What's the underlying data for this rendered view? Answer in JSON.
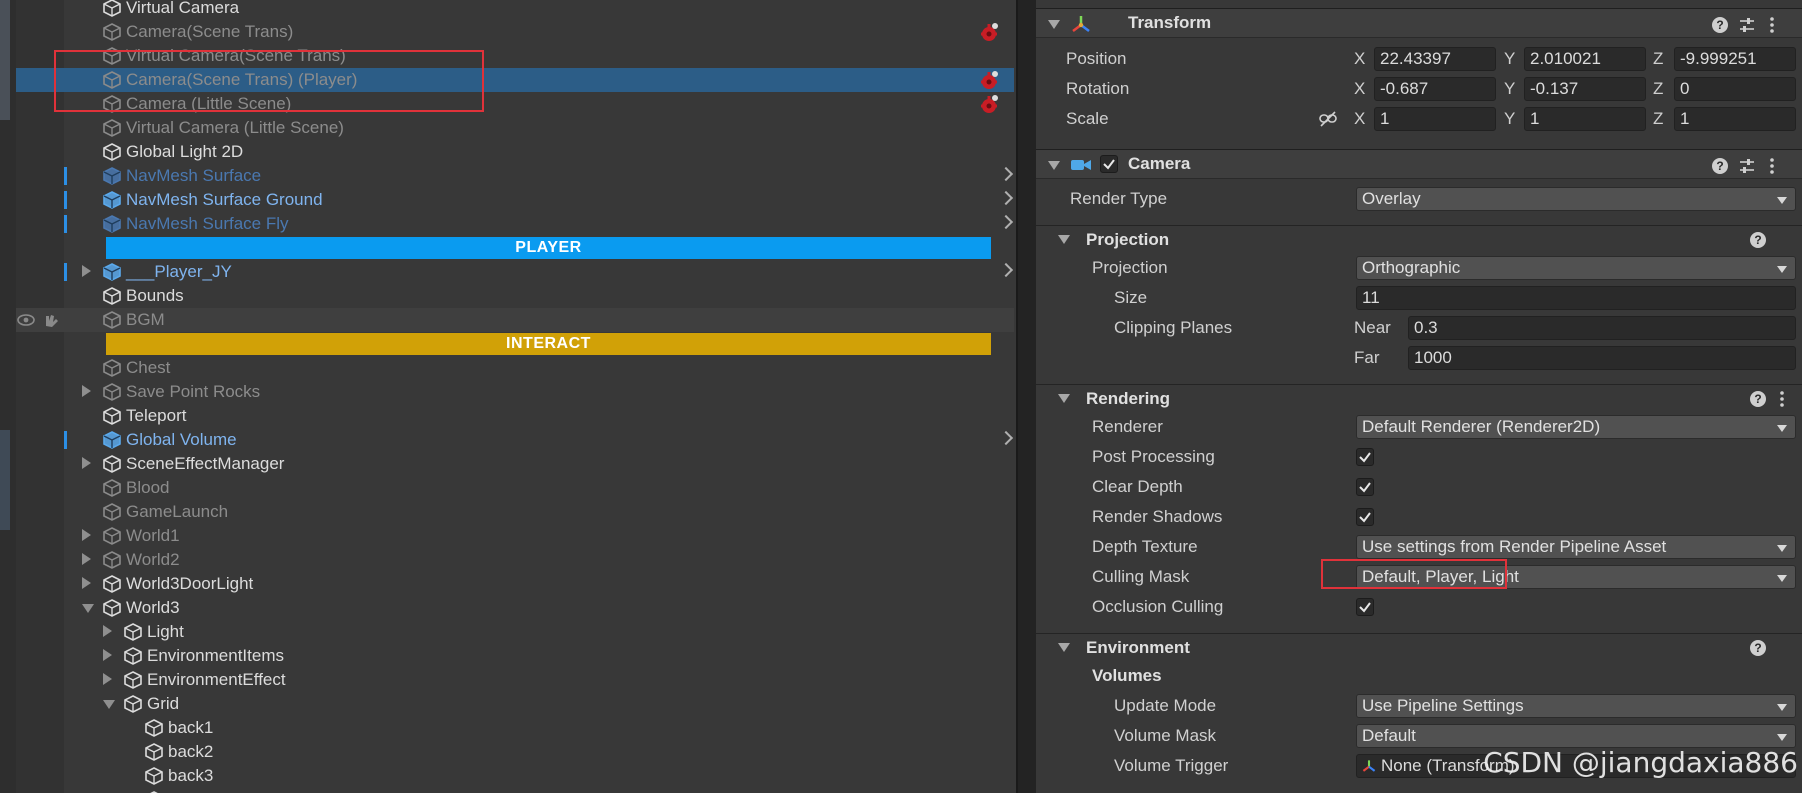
{
  "hierarchy": {
    "rows": [
      {
        "label": "Virtual Camera",
        "style": "normal",
        "depth": 0
      },
      {
        "label": "Camera(Scene Trans)",
        "style": "dim",
        "depth": 0,
        "gear": true
      },
      {
        "label": "Virtual Camera(Scene Trans)",
        "style": "dim",
        "depth": 0
      },
      {
        "label": "Camera(Scene Trans) (Player)",
        "style": "dim",
        "depth": 0,
        "gear": true,
        "selected": true
      },
      {
        "label": "Camera (Little Scene)",
        "style": "dim",
        "depth": 0,
        "gear": true
      },
      {
        "label": "Virtual Camera (Little Scene)",
        "style": "dim",
        "depth": 0
      },
      {
        "label": "Global Light 2D",
        "style": "normal",
        "depth": 0
      },
      {
        "label": "NavMesh Surface",
        "style": "prefab-dim",
        "depth": 0,
        "prefab": true,
        "chevron": true
      },
      {
        "label": "NavMesh Surface Ground",
        "style": "prefab",
        "depth": 0,
        "prefab": true,
        "chevron": true
      },
      {
        "label": "NavMesh Surface Fly",
        "style": "prefab-dim",
        "depth": 0,
        "prefab": true,
        "chevron": true
      },
      {
        "label": "PLAYER",
        "header": "#0a9bf0"
      },
      {
        "label": "___Player_JY",
        "style": "prefab",
        "depth": 0,
        "prefab": true,
        "chevron": true,
        "fold": "closed"
      },
      {
        "label": "Bounds",
        "style": "normal",
        "depth": 0
      },
      {
        "label": "BGM",
        "style": "dim",
        "depth": 0,
        "hovered": true
      },
      {
        "label": "INTERACT",
        "header": "#d1a107"
      },
      {
        "label": "Chest",
        "style": "dim",
        "depth": 0
      },
      {
        "label": "Save Point Rocks",
        "style": "dim",
        "depth": 0,
        "fold": "closed"
      },
      {
        "label": "Teleport",
        "style": "normal",
        "depth": 0
      },
      {
        "label": "Global Volume",
        "style": "prefab",
        "depth": 0,
        "prefab": true,
        "chevron": true
      },
      {
        "label": "SceneEffectManager",
        "style": "normal",
        "depth": 0,
        "fold": "closed"
      },
      {
        "label": "Blood",
        "style": "dim",
        "depth": 0
      },
      {
        "label": "GameLaunch",
        "style": "dim",
        "depth": 0
      },
      {
        "label": "World1",
        "style": "dim",
        "depth": 0,
        "fold": "closed"
      },
      {
        "label": "World2",
        "style": "dim",
        "depth": 0,
        "fold": "closed"
      },
      {
        "label": "World3DoorLight",
        "style": "normal",
        "depth": 0,
        "fold": "closed"
      },
      {
        "label": "World3",
        "style": "normal",
        "depth": 0,
        "fold": "open"
      },
      {
        "label": "Light",
        "style": "normal",
        "depth": 1,
        "fold": "closed"
      },
      {
        "label": "EnvironmentItems",
        "style": "normal",
        "depth": 1,
        "fold": "closed"
      },
      {
        "label": "EnvironmentEffect",
        "style": "normal",
        "depth": 1,
        "fold": "closed"
      },
      {
        "label": "Grid",
        "style": "normal",
        "depth": 1,
        "fold": "open"
      },
      {
        "label": "back1",
        "style": "normal",
        "depth": 2
      },
      {
        "label": "back2",
        "style": "normal",
        "depth": 2
      },
      {
        "label": "back3",
        "style": "normal",
        "depth": 2
      },
      {
        "label": "",
        "style": "normal",
        "depth": 2
      }
    ]
  },
  "inspector": {
    "transform": {
      "title": "Transform",
      "position": {
        "label": "Position",
        "x": "22.43397",
        "y": "2.010021",
        "z": "-9.999251"
      },
      "rotation": {
        "label": "Rotation",
        "x": "-0.687",
        "y": "-0.137",
        "z": "0"
      },
      "scale": {
        "label": "Scale",
        "x": "1",
        "y": "1",
        "z": "1"
      },
      "axis_x": "X",
      "axis_y": "Y",
      "axis_z": "Z"
    },
    "camera": {
      "title": "Camera",
      "enabled": true,
      "render_type": {
        "label": "Render Type",
        "value": "Overlay"
      },
      "projection_section": "Projection",
      "projection": {
        "label": "Projection",
        "value": "Orthographic"
      },
      "size": {
        "label": "Size",
        "value": "11"
      },
      "clipping": {
        "label": "Clipping Planes",
        "near_label": "Near",
        "near": "0.3",
        "far_label": "Far",
        "far": "1000"
      },
      "rendering_section": "Rendering",
      "renderer": {
        "label": "Renderer",
        "value": "Default Renderer (Renderer2D)"
      },
      "post_processing": {
        "label": "Post Processing",
        "checked": true
      },
      "clear_depth": {
        "label": "Clear Depth",
        "checked": true
      },
      "render_shadows": {
        "label": "Render Shadows",
        "checked": true
      },
      "depth_texture": {
        "label": "Depth Texture",
        "value": "Use settings from Render Pipeline Asset"
      },
      "culling_mask": {
        "label": "Culling Mask",
        "value": "Default, Player, Light"
      },
      "occlusion_culling": {
        "label": "Occlusion Culling",
        "checked": true
      },
      "environment_section": "Environment",
      "volumes_label": "Volumes",
      "update_mode": {
        "label": "Update Mode",
        "value": "Use Pipeline Settings"
      },
      "volume_mask": {
        "label": "Volume Mask",
        "value": "Default"
      },
      "volume_trigger": {
        "label": "Volume Trigger",
        "value": "None (Transform)"
      }
    }
  },
  "watermark": "CSDN @jiangdaxia886",
  "colors": {
    "selection": "#2c5d87",
    "highlight_box": "#e0323a",
    "player_header": "#0a9bf0",
    "interact_header": "#d1a107"
  },
  "icons": [
    "cube-icon",
    "prefab-cube-icon",
    "gear-warning-icon",
    "chevron-right-icon",
    "eye-icon",
    "hand-icon",
    "transform-axes-icon",
    "camera-icon",
    "help-icon",
    "preset-icon",
    "more-icon",
    "link-icon"
  ]
}
